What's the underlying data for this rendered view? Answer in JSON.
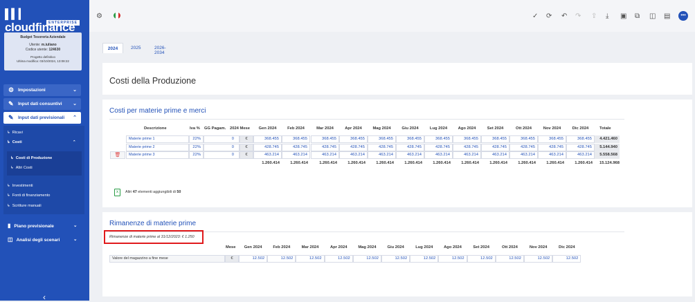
{
  "brand": {
    "name": "cloudfinance",
    "edition": "ENTERPRISE"
  },
  "user_box": {
    "budget": "Budget Tesoreria Aziendale",
    "user_label": "Utente:",
    "user": "m.iuliano",
    "code_label": "Codice utente:",
    "code": "124630",
    "status": "Progetto definitivo",
    "modified_label": "Ultima modifica:",
    "modified": "03/10/2024, 13:08:22"
  },
  "sidebar": {
    "impostazioni": "Impostazioni",
    "consuntivi": "Input dati consuntivi",
    "previsionali": "Input dati previsionali",
    "ricavi": "Ricavi",
    "costi": "Costi",
    "costi_produzione": "Costi di Produzione",
    "altri_costi": "Altri Costi",
    "investimenti": "Investimenti",
    "fonti": "Fonti di finanziamento",
    "scritture": "Scritture manuali",
    "piano": "Piano previsionale",
    "analisi": "Analisi degli scenari"
  },
  "topbar": {
    "avatar_label": "•••"
  },
  "tabs": [
    "2024",
    "2025",
    "2026-2034"
  ],
  "page_title": "Costi della Produzione",
  "materie": {
    "title": "Costi per materie prime e merci",
    "headers": {
      "descrizione": "Descrizione",
      "iva": "Iva %",
      "gg": "GG Pagam.",
      "mese": "2024 Mese",
      "totale": "Totale"
    },
    "months": [
      "Gen 2024",
      "Feb 2024",
      "Mar 2024",
      "Apr 2024",
      "Mag 2024",
      "Giu 2024",
      "Lug 2024",
      "Ago 2024",
      "Set 2024",
      "Ott 2024",
      "Nov 2024",
      "Dic 2024"
    ],
    "rows": [
      {
        "name": "Materie prime 1",
        "iva": "22%",
        "gg": "0",
        "currency": "€",
        "values": [
          "368.455",
          "368.455",
          "368.455",
          "368.455",
          "368.455",
          "368.455",
          "368.455",
          "368.455",
          "368.455",
          "368.455",
          "368.455",
          "368.455"
        ],
        "total": "4.421.460"
      },
      {
        "name": "Materie prime 2",
        "iva": "22%",
        "gg": "0",
        "currency": "€",
        "values": [
          "428.745",
          "428.745",
          "428.745",
          "428.745",
          "428.745",
          "428.745",
          "428.745",
          "428.745",
          "428.745",
          "428.745",
          "428.745",
          "428.745"
        ],
        "total": "5.144.940"
      },
      {
        "name": "Materie prime 3",
        "iva": "22%",
        "gg": "0",
        "currency": "€",
        "values": [
          "463.214",
          "463.214",
          "463.214",
          "463.214",
          "463.214",
          "463.214",
          "463.214",
          "463.214",
          "463.214",
          "463.214",
          "463.214",
          "463.214"
        ],
        "total": "5.558.568"
      }
    ],
    "totals": [
      "1.260.414",
      "1.260.414",
      "1.260.414",
      "1.260.414",
      "1.260.414",
      "1.260.414",
      "1.260.414",
      "1.260.414",
      "1.260.414",
      "1.260.414",
      "1.260.414",
      "1.260.414"
    ],
    "grand_total": "15.124.968",
    "add_note_pre": "Altri",
    "add_note_count": "47",
    "add_note_mid": "elementi aggiungibili di",
    "add_note_max": "50"
  },
  "rimanenze": {
    "title": "Rimanenze di materie prime",
    "note": "Rimanenze di materie prime al 31/12/2023: € 1.250",
    "mese_label": "Mese",
    "months": [
      "Gen 2024",
      "Feb 2024",
      "Mar 2024",
      "Apr 2024",
      "Mag 2024",
      "Giu 2024",
      "Lug 2024",
      "Ago 2024",
      "Set 2024",
      "Ott 2024",
      "Nov 2024",
      "Dic 2024"
    ],
    "row_label": "Valore del magazzino a fine mese",
    "currency": "€",
    "values": [
      "12.502",
      "12.502",
      "12.502",
      "12.502",
      "12.502",
      "12.502",
      "12.502",
      "12.502",
      "12.502",
      "12.502",
      "12.502",
      "12.502"
    ]
  },
  "colors": {
    "sidebar": "#2251b8",
    "accent": "#2251b8",
    "highlight": "#e0191b"
  },
  "icons": [
    "gear-icon",
    "italy-flag-icon",
    "check-icon",
    "refresh-icon",
    "undo-icon",
    "redo-icon",
    "upload-icon",
    "download-icon",
    "save-icon",
    "copy-icon",
    "columns-icon",
    "notes-icon",
    "more-icon",
    "excel-icon",
    "trash-icon"
  ]
}
